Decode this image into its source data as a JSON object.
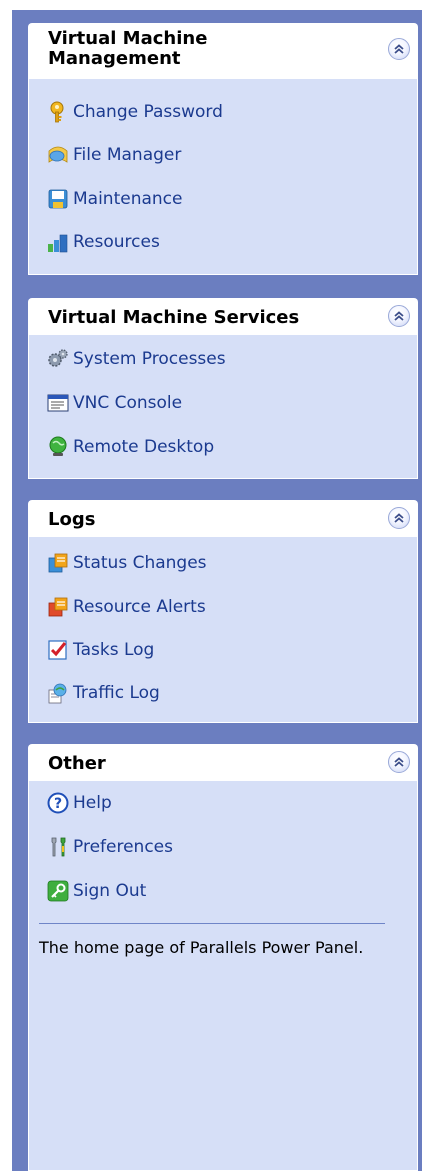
{
  "panels": [
    {
      "title": "Virtual Machine\nManagement",
      "items": [
        {
          "label": "Change Password",
          "icon": "key-icon"
        },
        {
          "label": "File Manager",
          "icon": "file-manager-icon"
        },
        {
          "label": "Maintenance",
          "icon": "floppy-disk-icon"
        },
        {
          "label": "Resources",
          "icon": "bar-chart-icon"
        }
      ]
    },
    {
      "title": "Virtual Machine Services",
      "items": [
        {
          "label": "System Processes",
          "icon": "gears-icon"
        },
        {
          "label": "VNC Console",
          "icon": "console-window-icon"
        },
        {
          "label": "Remote Desktop",
          "icon": "remote-desktop-icon"
        }
      ]
    },
    {
      "title": "Logs",
      "items": [
        {
          "label": "Status Changes",
          "icon": "status-changes-icon"
        },
        {
          "label": "Resource Alerts",
          "icon": "resource-alerts-icon"
        },
        {
          "label": "Tasks Log",
          "icon": "checklist-icon"
        },
        {
          "label": "Traffic Log",
          "icon": "traffic-log-icon"
        }
      ]
    },
    {
      "title": "Other",
      "items": [
        {
          "label": "Help",
          "icon": "help-icon"
        },
        {
          "label": "Preferences",
          "icon": "wrenches-icon"
        },
        {
          "label": "Sign Out",
          "icon": "sign-out-icon"
        }
      ],
      "description": "The home page of Parallels Power Panel."
    }
  ],
  "colors": {
    "sidebar_background": "#6b7ec0",
    "panel_header": "#ffffff",
    "panel_body": "#d6dff7",
    "link_text": "#1b3a8f"
  }
}
